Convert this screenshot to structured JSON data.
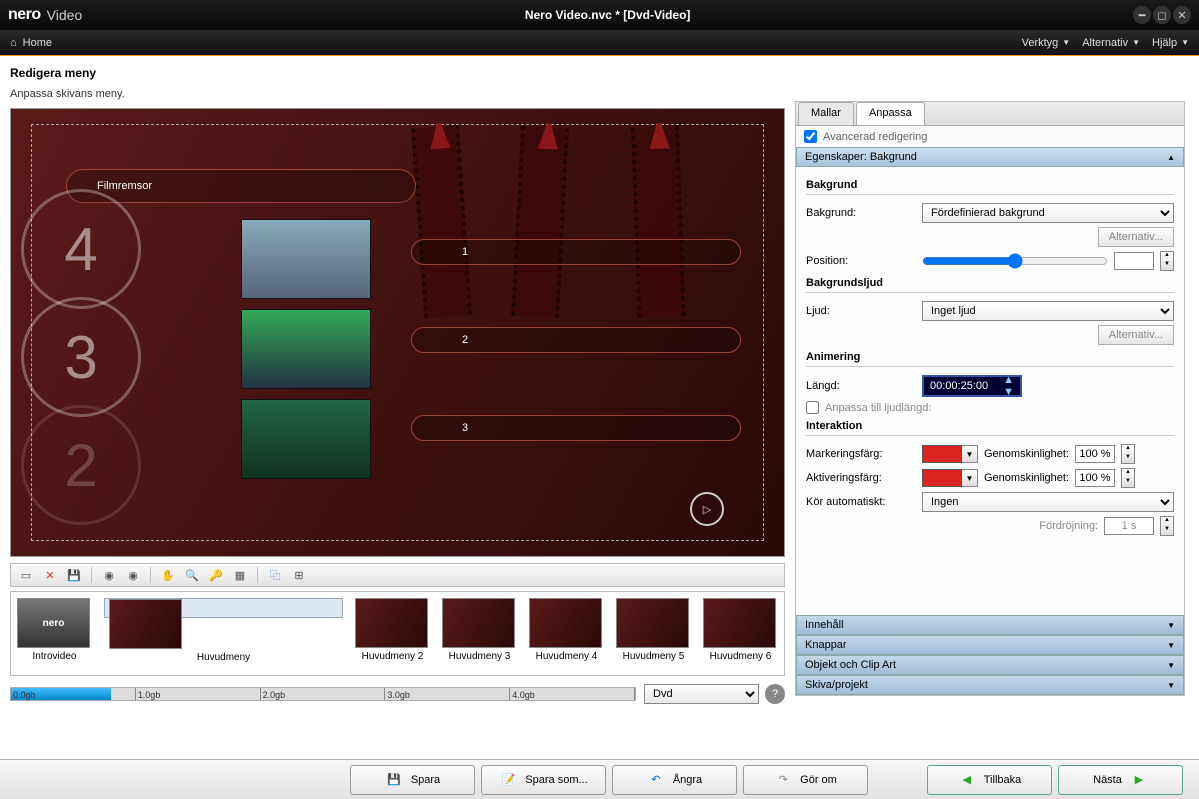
{
  "brand": "nero",
  "brand_sub": "Video",
  "window_title": "Nero Video.nvc * [Dvd-Video]",
  "menubar": {
    "home": "Home",
    "tools": "Verktyg",
    "options": "Alternativ",
    "help": "Hjälp"
  },
  "page": {
    "title": "Redigera meny",
    "subtitle": "Anpassa skivans meny."
  },
  "preview": {
    "menu_title": "Filmremsor",
    "links": [
      "1",
      "2",
      "3"
    ],
    "countdown": [
      "4",
      "3",
      "2"
    ]
  },
  "thumbstrip": [
    {
      "label": "Introvideo",
      "kind": "intro"
    },
    {
      "label": "Huvudmeny",
      "kind": "menu",
      "selected": true
    },
    {
      "label": "Huvudmeny 2",
      "kind": "menu"
    },
    {
      "label": "Huvudmeny 3",
      "kind": "menu"
    },
    {
      "label": "Huvudmeny 4",
      "kind": "menu"
    },
    {
      "label": "Huvudmeny 5",
      "kind": "menu"
    },
    {
      "label": "Huvudmeny 6",
      "kind": "menu"
    }
  ],
  "disk": {
    "ticks": [
      "0.0gb",
      "1.0gb",
      "2.0gb",
      "3.0gb",
      "4.0gb"
    ],
    "type": "Dvd"
  },
  "tabs": {
    "templates": "Mallar",
    "customize": "Anpassa"
  },
  "adv_edit": "Avancerad redigering",
  "sections": {
    "props_header": "Egenskaper: Bakgrund",
    "content": "Innehåll",
    "buttons": "Knappar",
    "clipart": "Objekt och Clip Art",
    "disc": "Skiva/projekt"
  },
  "props": {
    "bg_group": "Bakgrund",
    "bg_label": "Bakgrund:",
    "bg_value": "Fördefinierad bakgrund",
    "bg_options_btn": "Alternativ...",
    "pos_label": "Position:",
    "bgsound_group": "Bakgrundsljud",
    "sound_label": "Ljud:",
    "sound_value": "Inget ljud",
    "sound_options_btn": "Alternativ...",
    "anim_group": "Animering",
    "length_label": "Längd:",
    "length_value": "00:00:25:00",
    "fit_audio": "Anpassa till ljudlängd:",
    "interact_group": "Interaktion",
    "sel_color_label": "Markeringsfärg:",
    "act_color_label": "Aktiveringsfärg:",
    "opacity_label": "Genomskinlighet:",
    "opacity_value": "100 %",
    "auto_label": "Kör automatiskt:",
    "auto_value": "Ingen",
    "delay_label": "Fördröjning:",
    "delay_value": "1 s"
  },
  "buttons": {
    "save": "Spara",
    "saveas": "Spara som...",
    "undo": "Ångra",
    "redo": "Gör om",
    "back": "Tillbaka",
    "next": "Nästa"
  }
}
